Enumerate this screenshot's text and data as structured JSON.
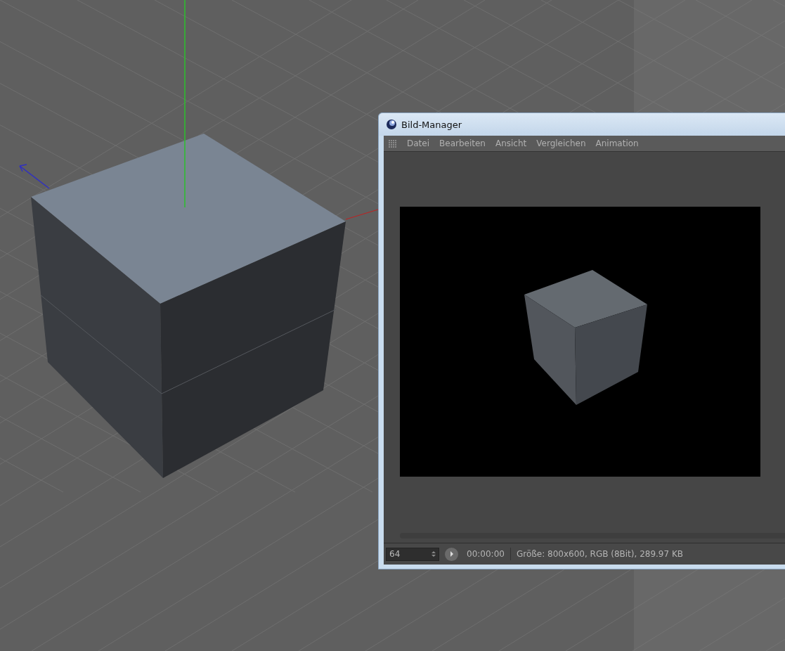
{
  "window": {
    "title": "Bild-Manager"
  },
  "menu": [
    "Datei",
    "Bearbeiten",
    "Ansicht",
    "Vergleichen",
    "Animation"
  ],
  "status_bar": {
    "frame_field": {
      "value": "64"
    },
    "time": "00:00:00",
    "info": "Größe: 800x600, RGB (8Bit), 289.97 KB"
  }
}
